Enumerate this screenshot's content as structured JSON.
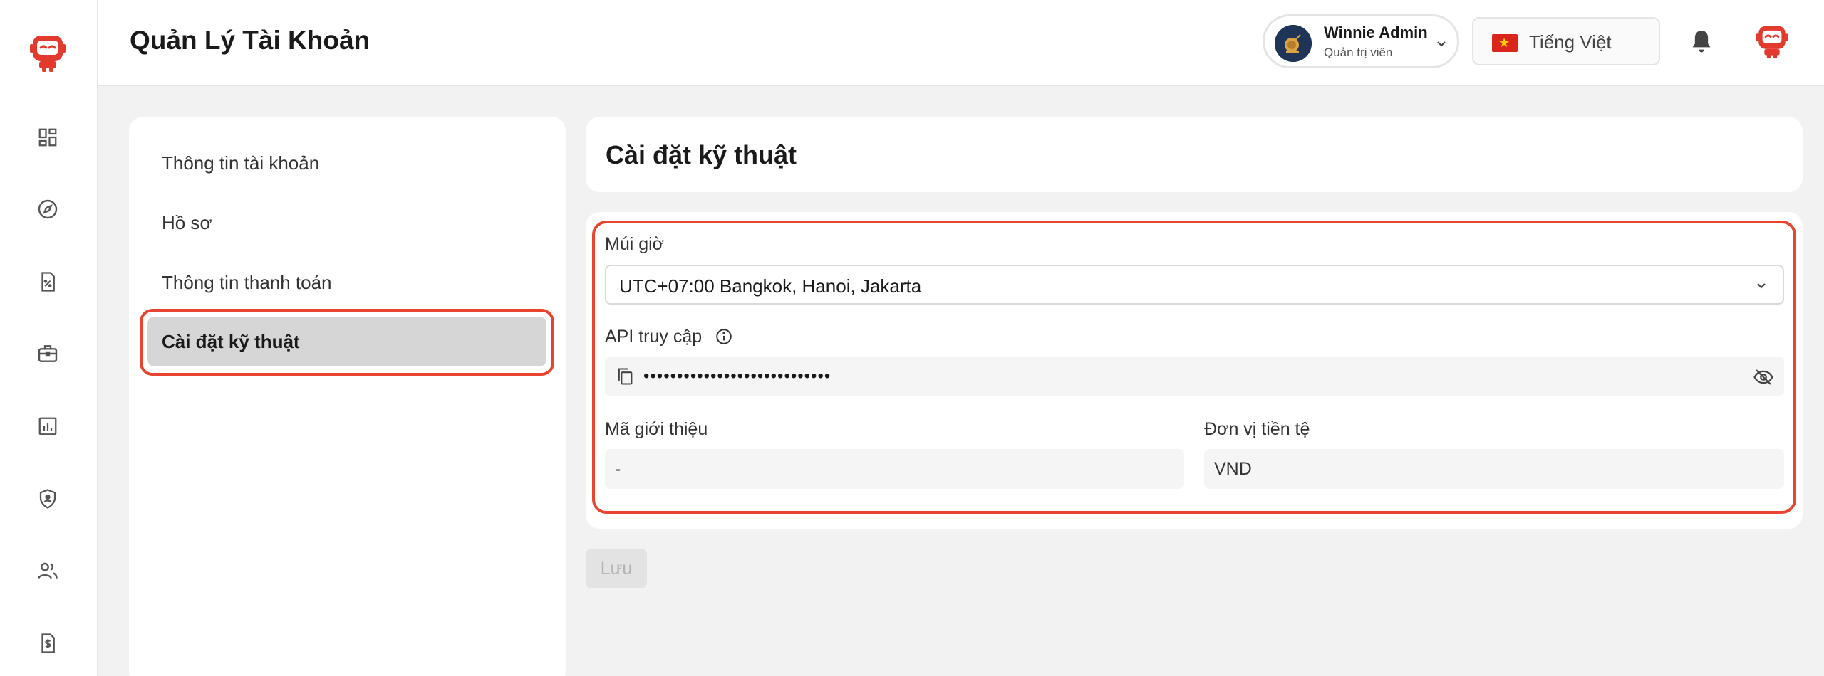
{
  "header": {
    "title": "Quản Lý Tài Khoản",
    "user": {
      "name": "Winnie Admin",
      "role": "Quản trị viên"
    },
    "language": {
      "label": "Tiếng Việt",
      "flag": "vietnam-flag-icon"
    },
    "notifications_icon": "bell-icon"
  },
  "sidebar": {
    "icons": [
      "dashboard-icon",
      "compass-icon",
      "receipt-percent-icon",
      "briefcase-icon",
      "bar-chart-icon",
      "shield-user-icon",
      "users-icon",
      "invoice-dollar-icon"
    ]
  },
  "menu": {
    "items": [
      {
        "label": "Thông tin tài khoản",
        "active": false
      },
      {
        "label": "Hồ sơ",
        "active": false
      },
      {
        "label": "Thông tin thanh toán",
        "active": false
      },
      {
        "label": "Cài đặt kỹ thuật",
        "active": true
      }
    ]
  },
  "section": {
    "title": "Cài đặt kỹ thuật"
  },
  "form": {
    "timezone": {
      "label": "Múi giờ",
      "value": "UTC+07:00 Bangkok, Hanoi, Jakarta"
    },
    "api": {
      "label": "API truy cập",
      "masked_value": "••••••••••••••••••••••••••••"
    },
    "referral": {
      "label": "Mã giới thiệu",
      "value": "-"
    },
    "currency": {
      "label": "Đơn vị tiền tệ",
      "value": "VND"
    },
    "save_label": "Lưu"
  },
  "colors": {
    "accent": "#e84530",
    "brand": "#e23b2e",
    "active_menu_bg": "#d6d6d6"
  }
}
